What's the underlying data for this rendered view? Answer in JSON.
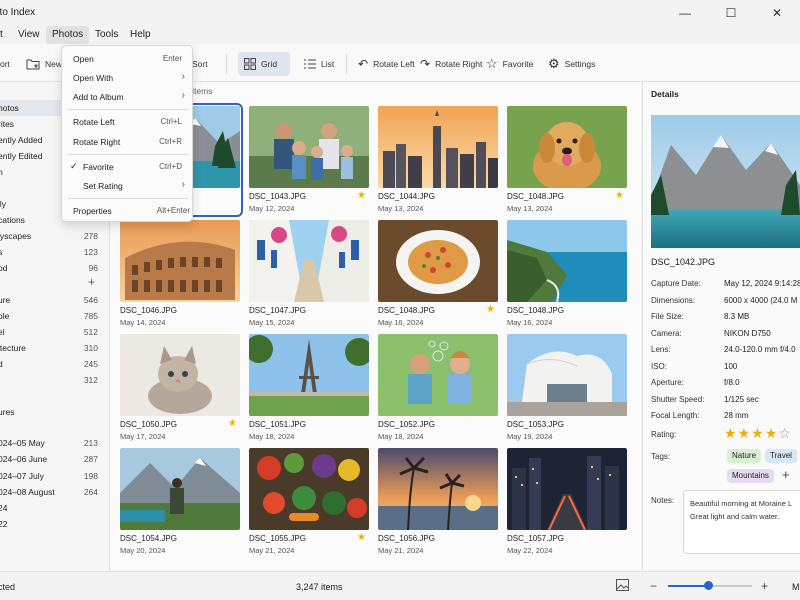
{
  "window": {
    "title": "oto Index",
    "minimize": "—",
    "maximize": "☐",
    "close": "✕"
  },
  "menubar": {
    "items": [
      "t",
      "View",
      "Photos",
      "Tools",
      "Help"
    ]
  },
  "toolbar": {
    "items": [
      "ort",
      "New",
      "Sort",
      "Grid",
      "List",
      "Rotate Left",
      "Rotate Right",
      "Favorite",
      "Settings"
    ]
  },
  "photos_menu": {
    "items": [
      {
        "label": "Open",
        "shortcut": "Enter"
      },
      {
        "label": "Open With",
        "submenu": true
      },
      {
        "label": "Add to Album",
        "submenu": true
      },
      {
        "label": "Rotate Left",
        "shortcut": "Ctrl+L"
      },
      {
        "label": "Rotate Right",
        "shortcut": "Ctrl+R"
      },
      {
        "label": "Favorite",
        "shortcut": "Ctrl+D",
        "checked": true
      },
      {
        "label": "Set Rating",
        "submenu": true
      },
      {
        "label": "Properties",
        "shortcut": "Alt+Enter"
      }
    ]
  },
  "sidebar": {
    "library": [
      "hotos",
      "rites",
      "ently Added",
      "ently Edited",
      "h"
    ],
    "albums": [
      {
        "label": "ily",
        "count": ""
      },
      {
        "label": "cations",
        "count": ""
      },
      {
        "label": "lyscapes",
        "count": "278"
      },
      {
        "label": "s",
        "count": "123"
      },
      {
        "label": "od",
        "count": "96"
      }
    ],
    "add_symbol": "+",
    "tags": [
      {
        "label": "ure",
        "count": "546"
      },
      {
        "label": "ple",
        "count": "785"
      },
      {
        "label": "el",
        "count": "512"
      },
      {
        "label": "itecture",
        "count": "310"
      },
      {
        "label": "d",
        "count": "245"
      },
      {
        "label": "",
        "count": "312"
      }
    ],
    "dates_header": "ures",
    "dates": [
      {
        "label": "024–05 May",
        "count": "213"
      },
      {
        "label": "024–06 June",
        "count": "287"
      },
      {
        "label": "024–07 July",
        "count": "198"
      },
      {
        "label": "024–08 August",
        "count": "264"
      },
      {
        "label": "24",
        "count": ""
      },
      {
        "label": "22",
        "count": ""
      }
    ]
  },
  "main": {
    "item_count_label": "7 items",
    "photos": [
      {
        "name": "",
        "date": "",
        "favorite": false,
        "scene": "lake"
      },
      {
        "name": "DSC_1043.JPG",
        "date": "May 12, 2024",
        "favorite": true,
        "scene": "family"
      },
      {
        "name": "DSC_1044.JPG",
        "date": "May 13, 2024",
        "favorite": false,
        "scene": "city"
      },
      {
        "name": "DSC_1048.JPG",
        "date": "May 13, 2024",
        "favorite": true,
        "scene": "dog"
      },
      {
        "name": "DSC_1046.JPG",
        "date": "May 14, 2024",
        "favorite": false,
        "scene": "colosseum"
      },
      {
        "name": "DSC_1047.JPG",
        "date": "May 15, 2024",
        "favorite": false,
        "scene": "street"
      },
      {
        "name": "DSC_1048.JPG",
        "date": "May 16, 2024",
        "favorite": true,
        "scene": "pasta"
      },
      {
        "name": "DSC_1048.JPG",
        "date": "May 16, 2024",
        "favorite": false,
        "scene": "coast"
      },
      {
        "name": "DSC_1050.JPG",
        "date": "May 17, 2024",
        "favorite": true,
        "scene": "kitten"
      },
      {
        "name": "DSC_1051.JPG",
        "date": "May 18, 2024",
        "favorite": false,
        "scene": "eiffel"
      },
      {
        "name": "DSC_1052.JPG",
        "date": "May 18, 2024",
        "favorite": false,
        "scene": "kids"
      },
      {
        "name": "DSC_1053.JPG",
        "date": "May 19, 2024",
        "favorite": false,
        "scene": "building"
      },
      {
        "name": "DSC_1054.JPG",
        "date": "May 20, 2024",
        "favorite": false,
        "scene": "hiker"
      },
      {
        "name": "DSC_1055.JPG",
        "date": "May 21, 2024",
        "favorite": true,
        "scene": "veggies"
      },
      {
        "name": "DSC_1056.JPG",
        "date": "May 21, 2024",
        "favorite": false,
        "scene": "beach"
      },
      {
        "name": "DSC_1057.JPG",
        "date": "May 22, 2024",
        "favorite": false,
        "scene": "night"
      }
    ]
  },
  "details": {
    "header": "Details",
    "filename": "DSC_1042.JPG",
    "rows": [
      {
        "key": "Capture Date:",
        "value": "May 12, 2024   9:14:28"
      },
      {
        "key": "Dimensions:",
        "value": "6000 x 4000 (24.0 M"
      },
      {
        "key": "File Size:",
        "value": "8.3 MB"
      },
      {
        "key": "Camera:",
        "value": "NIKON D750"
      },
      {
        "key": "Lens:",
        "value": "24.0-120.0 mm f/4.0"
      },
      {
        "key": "ISO:",
        "value": "100"
      },
      {
        "key": "Aperture:",
        "value": "f/8.0"
      },
      {
        "key": "Shutter Speed:",
        "value": "1/125 sec"
      },
      {
        "key": "Focal Length:",
        "value": "28 mm"
      }
    ],
    "rating_label": "Rating:",
    "rating": 4,
    "rating_max": 5,
    "tags_label": "Tags:",
    "tags": [
      {
        "label": "Nature",
        "color": "#d9efd4"
      },
      {
        "label": "Travel",
        "color": "#d7e7f7"
      },
      {
        "label": "Mountains",
        "color": "#e5dcf3"
      }
    ],
    "add_tag": "+",
    "notes_label": "Notes:",
    "notes": "Beautiful morning at Moraine L Great light and calm water."
  },
  "statusbar": {
    "left": "cted",
    "center": "3,247 items",
    "zoom_minus": "−",
    "zoom_plus": "+",
    "zoom_level": 0.48,
    "right": "M"
  },
  "colors": {
    "accent": "#2b63c6",
    "selection": "#e4e7ec",
    "star": "#f0b000"
  }
}
